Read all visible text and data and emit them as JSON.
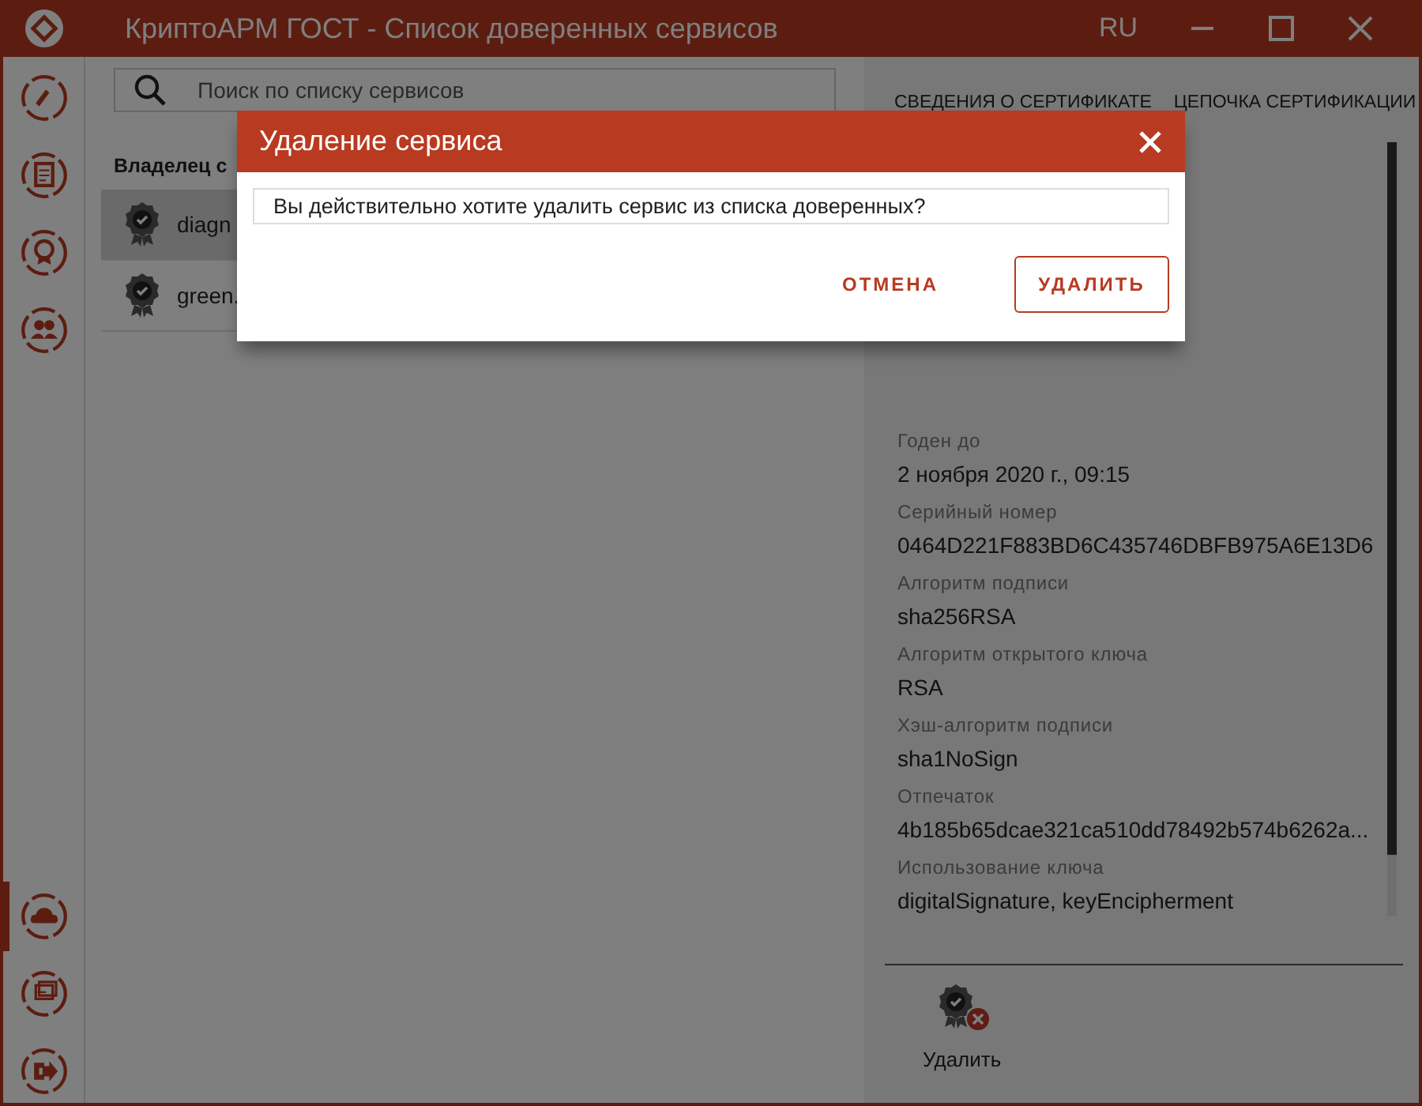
{
  "window": {
    "title": "КриптоАРМ ГОСТ - Список доверенных сервисов",
    "language": "RU"
  },
  "sidebar": {
    "items": [
      {
        "kind": "pen",
        "selected": false
      },
      {
        "kind": "document",
        "selected": false
      },
      {
        "kind": "certificate",
        "selected": false
      },
      {
        "kind": "people",
        "selected": false
      },
      {
        "kind": "cloud",
        "selected": true
      },
      {
        "kind": "windows",
        "selected": false
      },
      {
        "kind": "exit",
        "selected": false
      }
    ]
  },
  "services": {
    "search": {
      "placeholder": "Поиск по списку сервисов"
    },
    "column_header": "Владелец с",
    "rows": [
      {
        "name": "diagn",
        "selected": true
      },
      {
        "name": "green.",
        "selected": false
      }
    ]
  },
  "details": {
    "tabs": [
      "СВЕДЕНИЯ О СЕРТИФИКАТЕ",
      "ЦЕПОЧКА СЕРТИФИКАЦИИ"
    ],
    "fields": [
      {
        "label": "Годен до",
        "value": "2 ноября 2020 г., 09:15"
      },
      {
        "label": "Серийный номер",
        "value": "0464D221F883BD6C435746DBFB975A6E13D6"
      },
      {
        "label": "Алгоритм подписи",
        "value": "sha256RSA"
      },
      {
        "label": "Алгоритм открытого ключа",
        "value": "RSA"
      },
      {
        "label": "Хэш-алгоритм подписи",
        "value": "sha1NoSign"
      },
      {
        "label": "Отпечаток",
        "value": "4b185b65dcae321ca510dd78492b574b6262a..."
      },
      {
        "label": "Использование ключа",
        "value": "digitalSignature, keyEncipherment"
      }
    ],
    "action": "Удалить"
  },
  "dialog": {
    "title": "Удаление сервиса",
    "message": "Вы действительно хотите удалить сервис из списка доверенных?",
    "buttons": [
      {
        "kind": "text",
        "label": "ОТМЕНА"
      },
      {
        "kind": "outlined",
        "label": "УДАЛИТЬ"
      }
    ]
  }
}
